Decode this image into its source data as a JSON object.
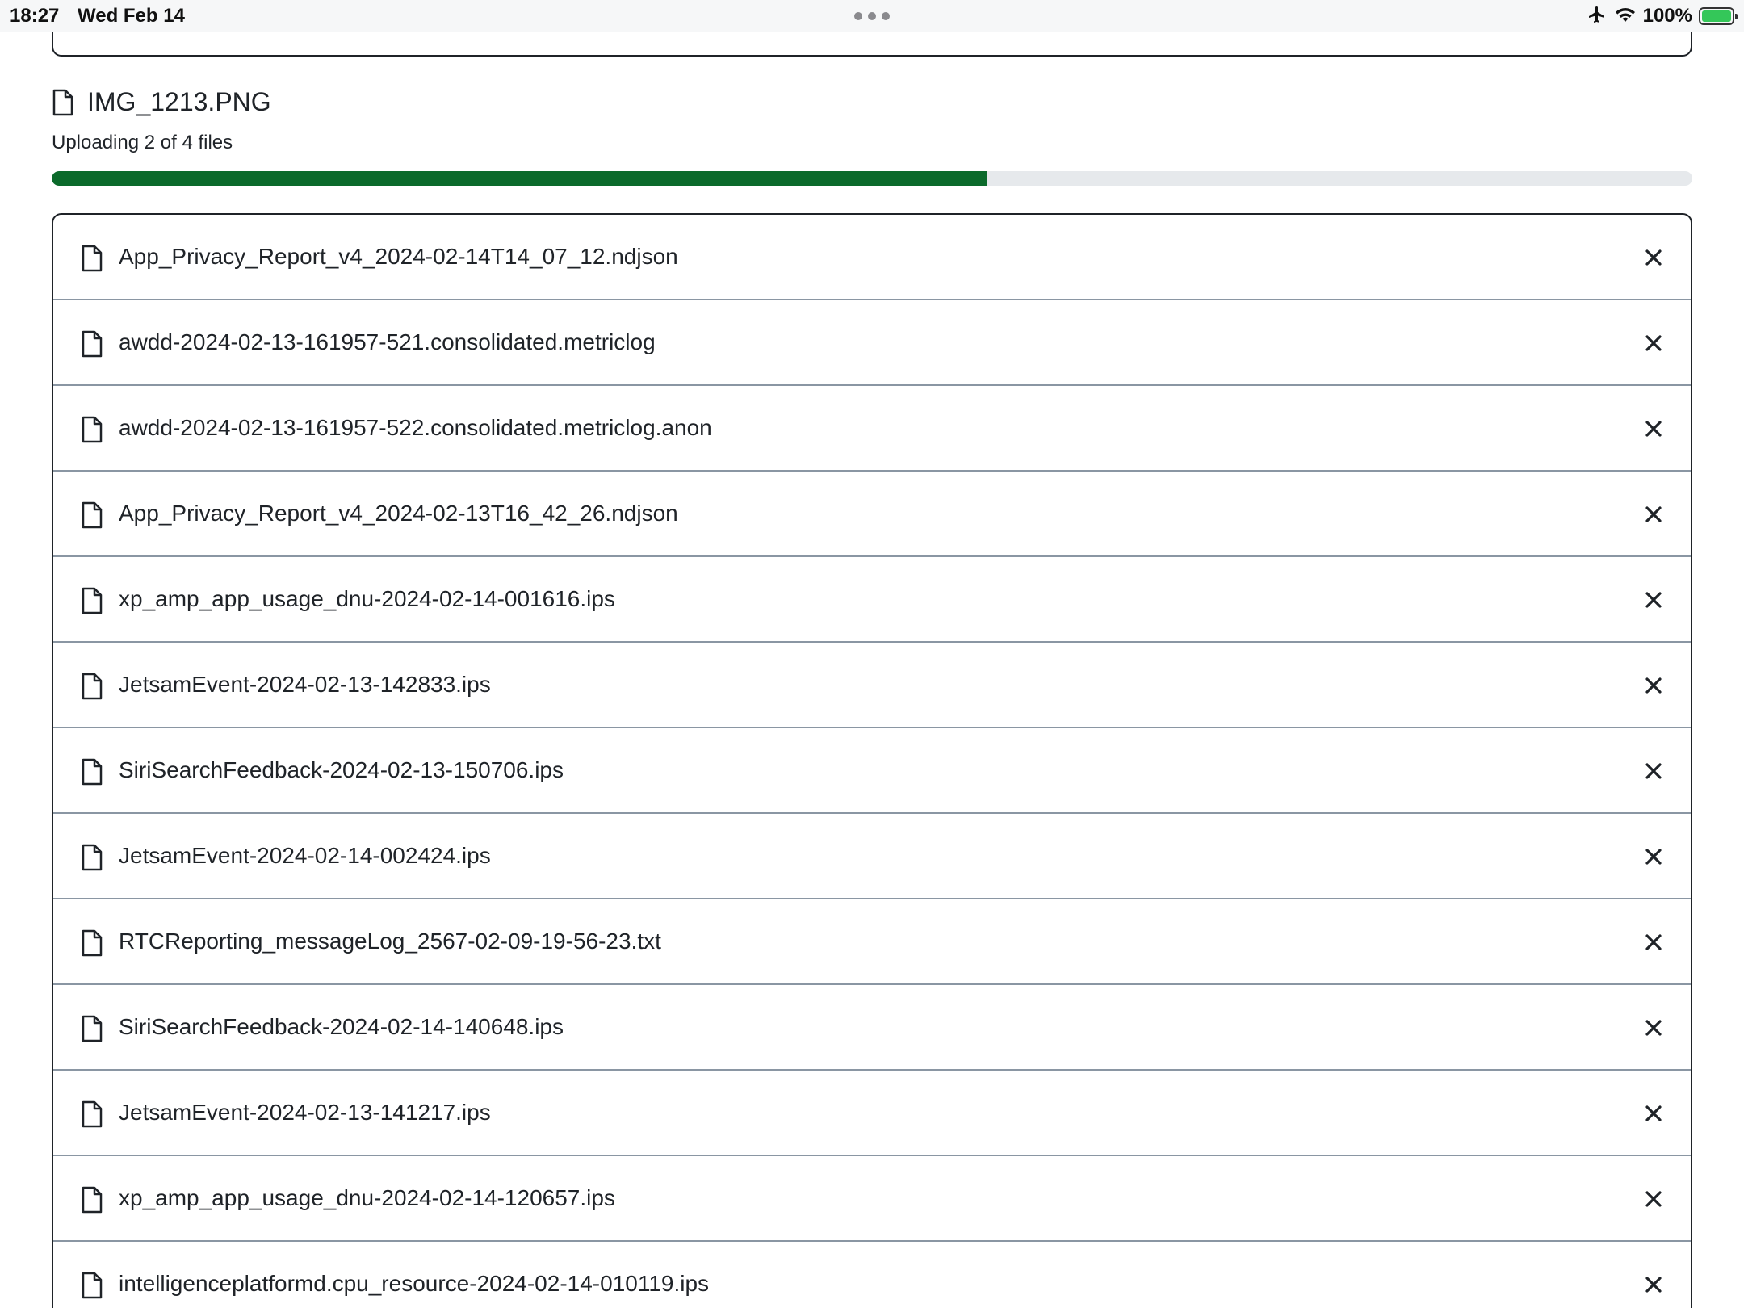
{
  "status_bar": {
    "time": "18:27",
    "date": "Wed Feb 14",
    "battery_percent": "100%",
    "icons": [
      "airplane-icon",
      "wifi-icon",
      "battery-charging-icon"
    ]
  },
  "upload": {
    "current_file": "IMG_1213.PNG",
    "status_text": "Uploading 2 of 4 files",
    "progress_fraction": 0.57,
    "progress_color": "#0b6a2b",
    "track_color": "#e6e9ec"
  },
  "files": [
    {
      "name": "App_Privacy_Report_v4_2024-02-14T14_07_12.ndjson"
    },
    {
      "name": "awdd-2024-02-13-161957-521.consolidated.metriclog"
    },
    {
      "name": "awdd-2024-02-13-161957-522.consolidated.metriclog.anon"
    },
    {
      "name": "App_Privacy_Report_v4_2024-02-13T16_42_26.ndjson"
    },
    {
      "name": "xp_amp_app_usage_dnu-2024-02-14-001616.ips"
    },
    {
      "name": "JetsamEvent-2024-02-13-142833.ips"
    },
    {
      "name": "SiriSearchFeedback-2024-02-13-150706.ips"
    },
    {
      "name": "JetsamEvent-2024-02-14-002424.ips"
    },
    {
      "name": "RTCReporting_messageLog_2567-02-09-19-56-23.txt"
    },
    {
      "name": "SiriSearchFeedback-2024-02-14-140648.ips"
    },
    {
      "name": "JetsamEvent-2024-02-13-141217.ips"
    },
    {
      "name": "xp_amp_app_usage_dnu-2024-02-14-120657.ips"
    },
    {
      "name": "intelligenceplatformd.cpu_resource-2024-02-14-010119.ips"
    }
  ]
}
